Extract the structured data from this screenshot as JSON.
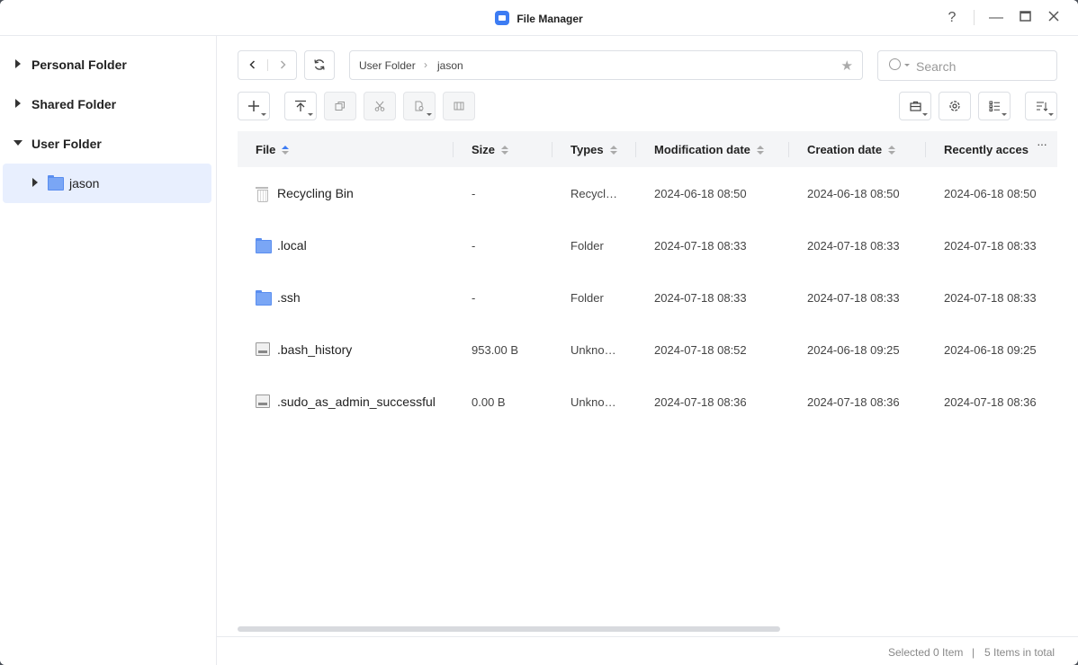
{
  "window": {
    "title": "File Manager"
  },
  "sidebar": {
    "items": [
      {
        "label": "Personal Folder"
      },
      {
        "label": "Shared Folder"
      },
      {
        "label": "User Folder"
      },
      {
        "label": "jason"
      }
    ]
  },
  "toolbar": {
    "breadcrumb": [
      "User Folder",
      "jason"
    ],
    "search_placeholder": "Search"
  },
  "table": {
    "columns": [
      "File",
      "Size",
      "Types",
      "Modification date",
      "Creation date",
      "Recently acces"
    ],
    "rows": [
      {
        "name": "Recycling Bin",
        "size": "-",
        "type": "Recycl…",
        "modified": "2024-06-18 08:50",
        "created": "2024-06-18 08:50",
        "accessed": "2024-06-18 08:50",
        "icon": "recycle-bin-icon"
      },
      {
        "name": ".local",
        "size": "-",
        "type": "Folder",
        "modified": "2024-07-18 08:33",
        "created": "2024-07-18 08:33",
        "accessed": "2024-07-18 08:33",
        "icon": "folder-icon"
      },
      {
        "name": ".ssh",
        "size": "-",
        "type": "Folder",
        "modified": "2024-07-18 08:33",
        "created": "2024-07-18 08:33",
        "accessed": "2024-07-18 08:33",
        "icon": "folder-icon"
      },
      {
        "name": ".bash_history",
        "size": "953.00 B",
        "type": "Unkno…",
        "modified": "2024-07-18 08:52",
        "created": "2024-06-18 09:25",
        "accessed": "2024-06-18 09:25",
        "icon": "file-icon"
      },
      {
        "name": ".sudo_as_admin_successful",
        "size": "0.00 B",
        "type": "Unkno…",
        "modified": "2024-07-18 08:36",
        "created": "2024-07-18 08:36",
        "accessed": "2024-07-18 08:36",
        "icon": "file-icon"
      }
    ]
  },
  "status": {
    "selected": "Selected 0 Item",
    "separator": "|",
    "total": "5 Items in total"
  },
  "colors": {
    "accent": "#3d7cf3",
    "selection": "#e8effe",
    "folder": "#7aa6f5"
  }
}
